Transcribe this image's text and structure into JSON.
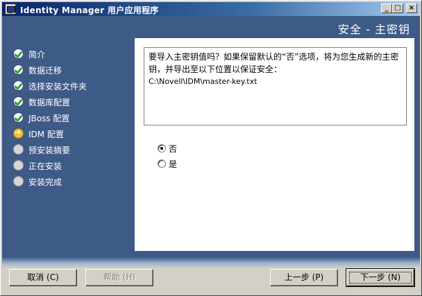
{
  "window": {
    "title": "Identity Manager 用户应用程序",
    "controls": {
      "minimize": "_",
      "maximize": "□",
      "close": "×"
    }
  },
  "header": {
    "title": "安全 - 主密钥"
  },
  "steps": [
    {
      "label": "简介",
      "status": "done"
    },
    {
      "label": "数据迁移",
      "status": "done"
    },
    {
      "label": "选择安装文件夹",
      "status": "done"
    },
    {
      "label": "数据库配置",
      "status": "done"
    },
    {
      "label": "JBoss 配置",
      "status": "done"
    },
    {
      "label": "IDM 配置",
      "status": "current"
    },
    {
      "label": "预安装摘要",
      "status": "pending"
    },
    {
      "label": "正在安装",
      "status": "pending"
    },
    {
      "label": "安装完成",
      "status": "pending"
    }
  ],
  "message": {
    "text": "要导入主密钥值吗？如果保留默认的“否”选项，将为您生成新的主密钥，并导出至以下位置以保证安全：",
    "path": "C:\\Novell\\IDM\\master-key.txt"
  },
  "options": [
    {
      "label": "否",
      "selected": true
    },
    {
      "label": "是",
      "selected": false
    }
  ],
  "buttons": {
    "cancel": "取消 (C)",
    "help": "帮助 (H)",
    "previous": "上一步 (P)",
    "next": "下一步 (N)"
  }
}
